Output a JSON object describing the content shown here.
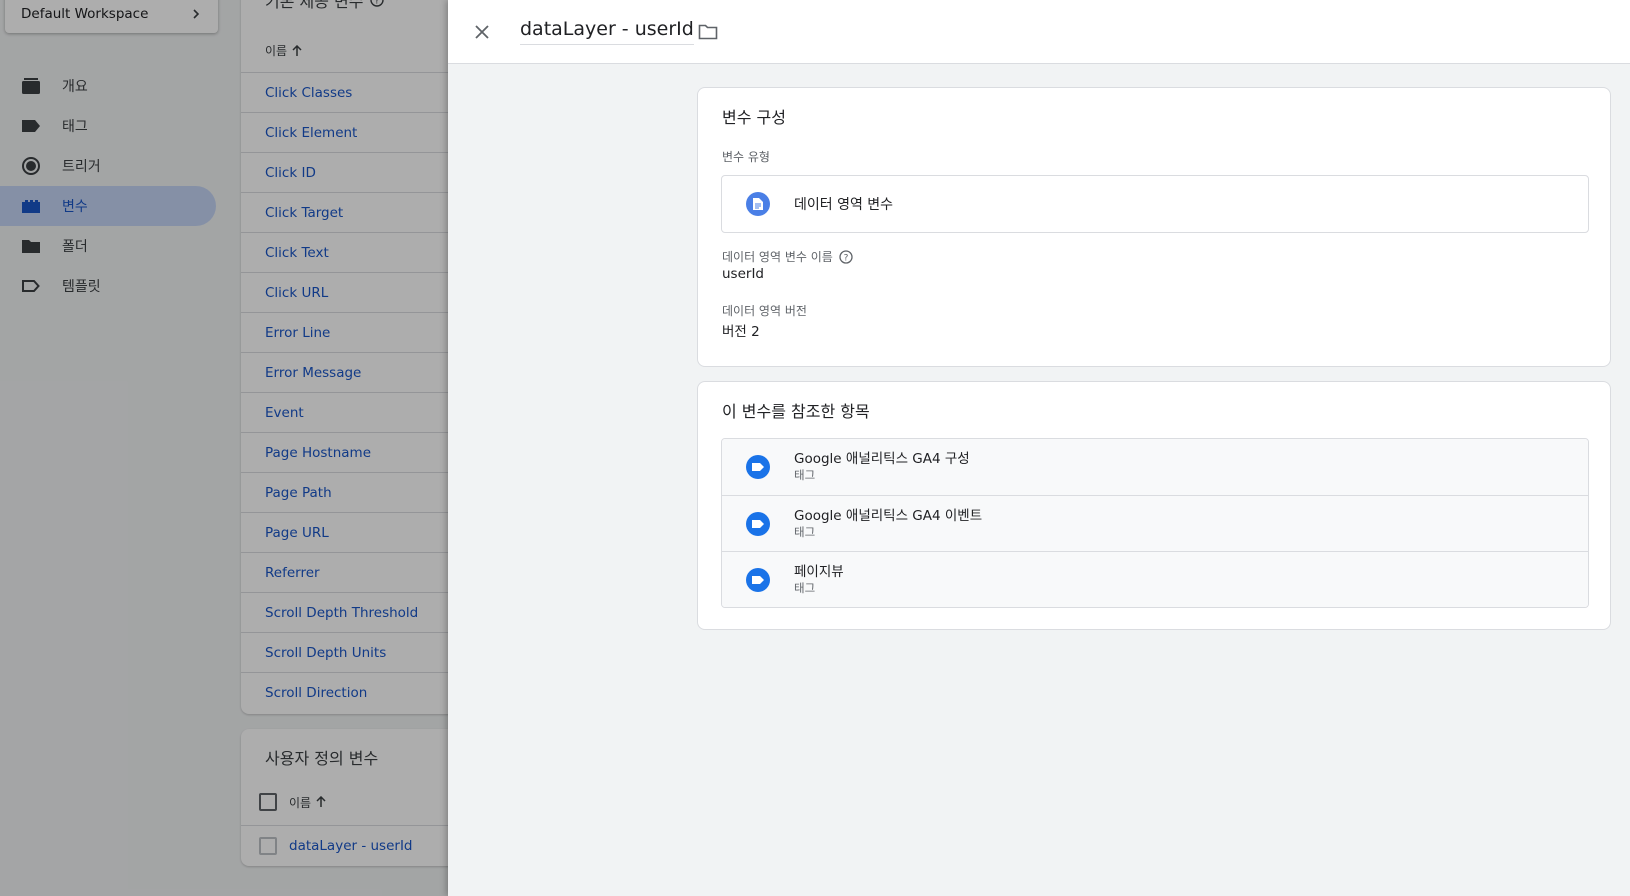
{
  "workspace": {
    "label": "Default Workspace"
  },
  "sidenav": {
    "items": [
      {
        "label": "개요",
        "icon": "overview-icon"
      },
      {
        "label": "태그",
        "icon": "tag-icon"
      },
      {
        "label": "트리거",
        "icon": "trigger-icon"
      },
      {
        "label": "변수",
        "icon": "variable-icon",
        "active": true
      },
      {
        "label": "폴더",
        "icon": "folder-icon"
      },
      {
        "label": "템플릿",
        "icon": "template-icon"
      }
    ]
  },
  "builtin_vars": {
    "title": "기본 제공 변수",
    "column_header": "이름",
    "rows": [
      "Click Classes",
      "Click Element",
      "Click ID",
      "Click Target",
      "Click Text",
      "Click URL",
      "Error Line",
      "Error Message",
      "Event",
      "Page Hostname",
      "Page Path",
      "Page URL",
      "Referrer",
      "Scroll Depth Threshold",
      "Scroll Depth Units",
      "Scroll Direction"
    ]
  },
  "custom_vars": {
    "title": "사용자 정의 변수",
    "column_header": "이름",
    "rows": [
      "dataLayer - userId"
    ]
  },
  "panel": {
    "title": "dataLayer - userId",
    "config": {
      "heading": "변수 구성",
      "type_label": "변수 유형",
      "type_value": "데이터 영역 변수",
      "name_label": "데이터 영역 변수 이름",
      "name_value": "userId",
      "version_label": "데이터 영역 버전",
      "version_value": "버전 2"
    },
    "references": {
      "heading": "이 변수를 참조한 항목",
      "items": [
        {
          "name": "Google 애널리틱스 GA4 구성",
          "type": "태그"
        },
        {
          "name": "Google 애널리틱스 GA4 이벤트",
          "type": "태그"
        },
        {
          "name": "페이지뷰",
          "type": "태그"
        }
      ]
    }
  },
  "colors": {
    "accent": "#1a73e8",
    "link": "#1a56c8",
    "active_nav_bg": "#c5d5f5"
  }
}
